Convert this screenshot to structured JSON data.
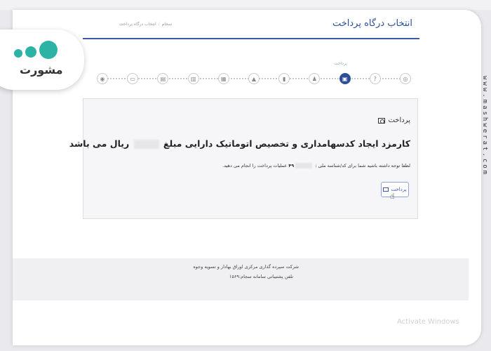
{
  "header": {
    "page_title": "انتخاب درگاه پرداخت",
    "breadcrumb": [
      "سجام",
      "انتخاب درگاه پرداخت"
    ]
  },
  "stepper": {
    "active_label": "پرداخت",
    "steps": [
      {
        "icon": "location-icon"
      },
      {
        "icon": "question-icon"
      },
      {
        "icon": "payment-icon",
        "active": true
      },
      {
        "icon": "person-icon"
      },
      {
        "icon": "bookmark-icon"
      },
      {
        "icon": "graduation-cap-icon"
      },
      {
        "icon": "calendar-icon"
      },
      {
        "icon": "bank-icon"
      },
      {
        "icon": "document-icon"
      },
      {
        "icon": "card-icon"
      },
      {
        "icon": "wallet-icon"
      }
    ]
  },
  "card": {
    "title": "پرداخت",
    "headline_before": "کارمزد ایجاد کدسهامداری و تخصیص اتوماتیک دارایی مبلغ",
    "headline_after": "ریال می باشد",
    "note_before": "لطفا توجه داشته باشید شما برای کد/شناسه ملی :",
    "note_digits": "۴۹",
    "note_after": "عملیات پرداخت را انجام می دهید.",
    "pay_button": "پرداخت"
  },
  "footer": {
    "line1": "شرکت سپرده گذاری مرکزی اوراق بهادار و تسویه وجوه",
    "line2": "تلفن پشتیبانی سامانه سجام:۱۵۶۹"
  },
  "watermark": {
    "logo_text": "مشورت",
    "vertical": "www.mashwerat.com",
    "windows": "Activate Windows"
  },
  "colors": {
    "accent": "#2d4f99",
    "logo": "#2db3a5"
  }
}
